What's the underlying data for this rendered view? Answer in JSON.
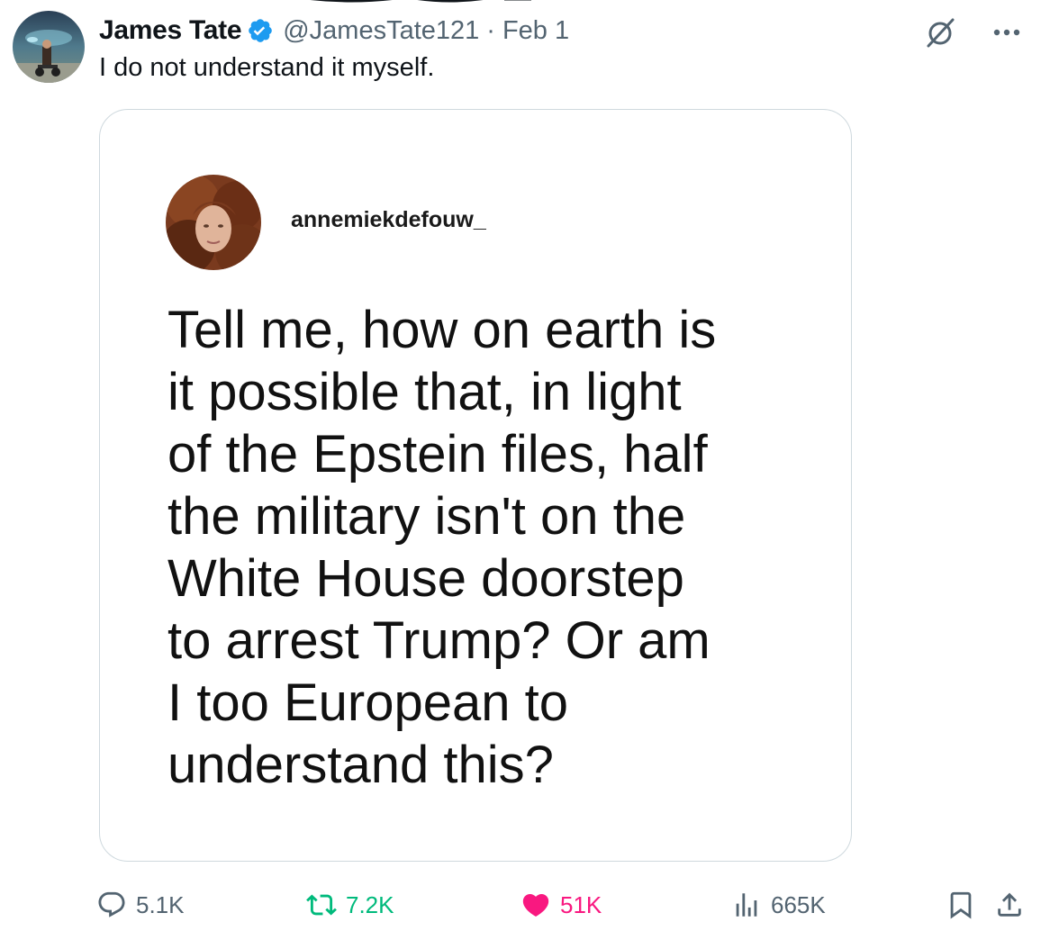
{
  "tweet": {
    "author": {
      "display_name": "James Tate",
      "handle": "@JamesTate121",
      "verified": true
    },
    "separator": "·",
    "date": "Feb 1",
    "text": "I do not understand it myself.",
    "icons": {
      "verified": "verified-badge-icon",
      "grok": "grok-icon",
      "more": "more-horizontal-icon"
    }
  },
  "media": {
    "username": "annemiekdefouw_",
    "quote_lines": [
      "Tell me, how on earth is",
      "it possible that, in light",
      "of the Epstein files, half",
      "the military isn't on the",
      "White House doorstep",
      "to arrest Trump? Or am",
      "I too European to",
      "understand this?"
    ]
  },
  "actions": {
    "replies": "5.1K",
    "reposts": "7.2K",
    "likes": "51K",
    "views": "665K",
    "liked": true
  },
  "colors": {
    "text_primary": "#0f1419",
    "text_secondary": "#536471",
    "verified_blue": "#1d9bf0",
    "repost_green": "#00ba7c",
    "like_pink": "#f91880",
    "card_border": "#cfd9de"
  }
}
